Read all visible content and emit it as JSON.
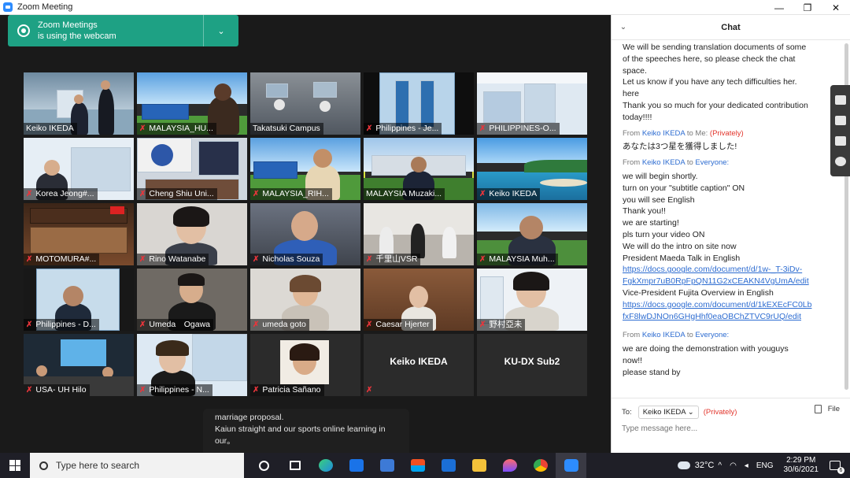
{
  "window": {
    "title": "Zoom Meeting",
    "minimize": "—",
    "maximize": "❐",
    "close": "✕"
  },
  "webcam_notice": {
    "line1": "Zoom Meetings",
    "line2": "is using the webcam",
    "chevron": "⌄"
  },
  "participants": [
    {
      "name": "Keiko IKEDA",
      "muted": false
    },
    {
      "name": "MALAYSIA_HU...",
      "muted": true
    },
    {
      "name": "Takatsuki Campus",
      "muted": false
    },
    {
      "name": "Philippines - Je...",
      "muted": true
    },
    {
      "name": "PHILIPPINES-O...",
      "muted": true
    },
    {
      "name": "Korea Jeong#...",
      "muted": true
    },
    {
      "name": "Cheng Shiu Uni...",
      "muted": true
    },
    {
      "name": "MALAYSIA_RIH...",
      "muted": true
    },
    {
      "name": "MALAYSIA Muzaki...",
      "muted": false
    },
    {
      "name": "Keiko IKEDA",
      "muted": true
    },
    {
      "name": "MOTOMURA#...",
      "muted": true
    },
    {
      "name": "Rino Watanabe",
      "muted": true
    },
    {
      "name": "Nicholas Souza",
      "muted": true
    },
    {
      "name": "千里山VSR",
      "muted": true
    },
    {
      "name": "MALAYSIA Muh...",
      "muted": true
    },
    {
      "name": "Philippines - D...",
      "muted": true
    },
    {
      "name": "Umeda　Ogawa",
      "muted": true
    },
    {
      "name": "umeda goto",
      "muted": true
    },
    {
      "name": "Caesar Hjerter",
      "muted": true
    },
    {
      "name": "野村亞未",
      "muted": true
    },
    {
      "name": "USA- UH Hilo",
      "muted": true
    },
    {
      "name": "Philippines - N...",
      "muted": true
    },
    {
      "name": "Patricia Sañano",
      "muted": true
    },
    {
      "name": "Keiko IKEDA",
      "muted": true
    },
    {
      "name": "KU-DX Sub2",
      "muted": false
    }
  ],
  "caption": {
    "line1": "marriage proposal.",
    "line2": "Kaiun straight and our sports online learning in",
    "line3": "our。"
  },
  "chat": {
    "title": "Chat",
    "messages": {
      "m1": [
        "We will be sending translation documents of some",
        "of the speeches here, so please check the chat",
        "space.",
        "Let us know if you have any tech difficulties her.",
        "here",
        "Thank you so much for your dedicated contribution",
        "today!!!!"
      ],
      "m2_from": "From",
      "m2_sender": "Keiko IKEDA",
      "m2_to": "to",
      "m2_recipient": "Me:",
      "m2_private": "(Privately)",
      "m2_text": "あなたは3つ星を獲得しました!",
      "m3_from": "From",
      "m3_sender": "Keiko IKEDA",
      "m3_to": "to",
      "m3_recipient": "Everyone:",
      "m3_lines": [
        "we will begin shortly.",
        "turn on your \"subtitle caption\" ON",
        "you will see English",
        "Thank you!!",
        "we are starting!",
        "pls turn your video ON",
        "We will do the intro on site now",
        "President Maeda Talk in English"
      ],
      "link1_a": "https://docs.google.com/document/d/1w-_T-3iDv-",
      "link1_b": "FgkXmpr7uB0RpFpQN11G2xCEAKN4VgUmA/edit",
      "m3_lines2": [
        "Vice-President Fujita Overview in English"
      ],
      "link2_a": "https://docs.google.com/document/d/1kEXEcFC0Lb",
      "link2_b": "fxF8lwDJNOn6GHgHhf0eaOBChZTVC9rUQ/edit",
      "m4_from": "From",
      "m4_sender": "Keiko IKEDA",
      "m4_to": "to",
      "m4_recipient": "Everyone:",
      "m4_lines": [
        "we are doing the demonstration with youguys",
        "now!!",
        "please stand by"
      ]
    },
    "to_label": "To:",
    "to_value": "Keiko IKEDA ⌄",
    "to_private": "(Privately)",
    "file_label": "File",
    "input_placeholder": "Type message here..."
  },
  "taskbar": {
    "search_placeholder": "Type here to search",
    "weather": "32°C",
    "lang": "ENG",
    "time": "2:29 PM",
    "date": "30/6/2021",
    "notification_count": "6"
  },
  "colors": {
    "accent": "#2d8cff",
    "webcam_banner": "#1ea184",
    "active_speaker": "#d7e33e",
    "muted": "#e8353b",
    "private": "#e2352c",
    "link": "#2d6cd1"
  }
}
